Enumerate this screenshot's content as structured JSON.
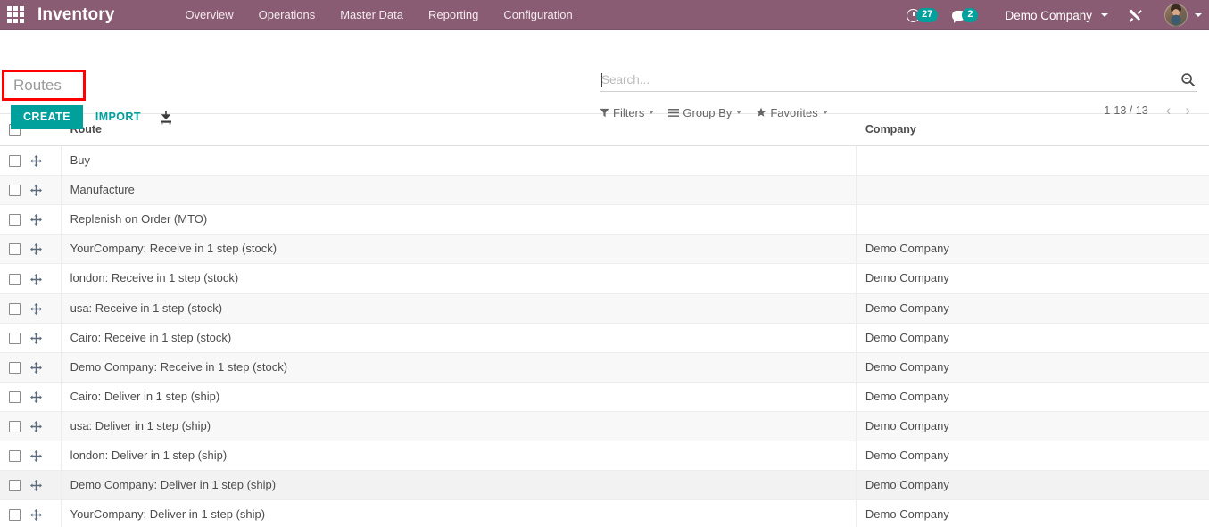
{
  "theme": {
    "navbar_bg": "#8a5c73",
    "accent": "#00a09d",
    "highlight_box": "#ff0000",
    "row_alt_bg": "#f8f8f9"
  },
  "navbar": {
    "apps_icon": "apps-grid-icon",
    "brand": "Inventory",
    "menu": [
      {
        "label": "Overview"
      },
      {
        "label": "Operations"
      },
      {
        "label": "Master Data"
      },
      {
        "label": "Reporting"
      },
      {
        "label": "Configuration"
      }
    ],
    "activities": {
      "icon": "clock-icon",
      "count": "27"
    },
    "messages": {
      "icon": "chat-bubble-icon",
      "count": "2"
    },
    "company": "Demo Company",
    "tools_icon": "wrench-screwdriver-icon",
    "avatar": "user-avatar"
  },
  "control_panel": {
    "breadcrumb": "Routes",
    "create_label": "CREATE",
    "import_label": "IMPORT",
    "download_icon": "download-icon"
  },
  "search": {
    "placeholder": "Search...",
    "value": "",
    "search_icon": "magnifier-icon",
    "filters_label": "Filters",
    "filters_icon": "funnel-icon",
    "groupby_label": "Group By",
    "groupby_icon": "hamburger-icon",
    "favorites_label": "Favorites",
    "favorites_icon": "star-icon",
    "pager_count": "1-13 / 13",
    "pager_prev": "‹",
    "pager_next": "›"
  },
  "table": {
    "columns": {
      "route": "Route",
      "company": "Company"
    },
    "rows": [
      {
        "route": "Buy",
        "company": ""
      },
      {
        "route": "Manufacture",
        "company": ""
      },
      {
        "route": "Replenish on Order (MTO)",
        "company": ""
      },
      {
        "route": "YourCompany: Receive in 1 step (stock)",
        "company": "Demo Company"
      },
      {
        "route": "london: Receive in 1 step (stock)",
        "company": "Demo Company"
      },
      {
        "route": "usa: Receive in 1 step (stock)",
        "company": "Demo Company"
      },
      {
        "route": "Cairo: Receive in 1 step (stock)",
        "company": "Demo Company"
      },
      {
        "route": "Demo Company: Receive in 1 step (stock)",
        "company": "Demo Company"
      },
      {
        "route": "Cairo: Deliver in 1 step (ship)",
        "company": "Demo Company"
      },
      {
        "route": "usa: Deliver in 1 step (ship)",
        "company": "Demo Company"
      },
      {
        "route": "london: Deliver in 1 step (ship)",
        "company": "Demo Company"
      },
      {
        "route": "Demo Company: Deliver in 1 step (ship)",
        "company": "Demo Company"
      },
      {
        "route": "YourCompany: Deliver in 1 step (ship)",
        "company": "Demo Company"
      }
    ]
  }
}
